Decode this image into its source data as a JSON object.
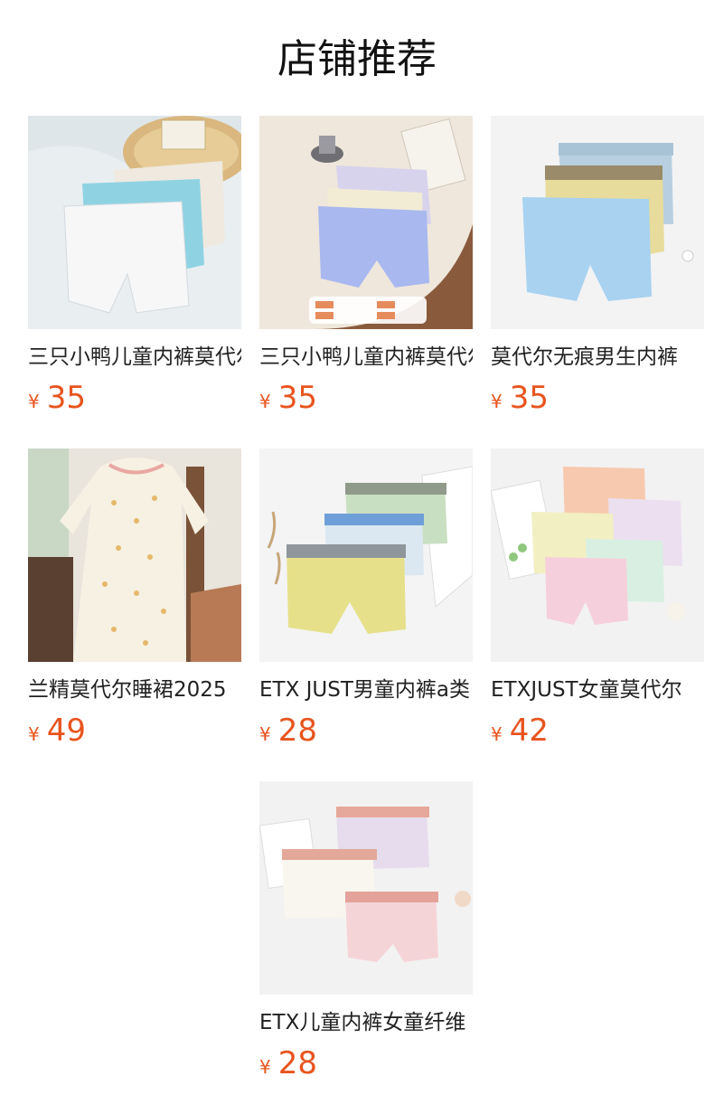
{
  "section": {
    "title": "店铺推荐"
  },
  "products": [
    {
      "name": "三只小鸭儿童内裤莫代尔",
      "currency": "¥",
      "price": "35",
      "image_icon": "kids-underwear-photo-icon"
    },
    {
      "name": "三只小鸭儿童内裤莫代尔",
      "currency": "¥",
      "price": "35",
      "image_icon": "kids-underwear-photo-icon"
    },
    {
      "name": "莫代尔无痕男生内裤",
      "currency": "¥",
      "price": "35",
      "image_icon": "boxer-briefs-photo-icon"
    },
    {
      "name": "兰精莫代尔睡裙2025",
      "currency": "¥",
      "price": "49",
      "image_icon": "nightdress-photo-icon"
    },
    {
      "name": "ETX JUST男童内裤a类",
      "currency": "¥",
      "price": "28",
      "image_icon": "boxer-briefs-photo-icon"
    },
    {
      "name": "ETXJUST女童莫代尔",
      "currency": "¥",
      "price": "42",
      "image_icon": "girls-underwear-photo-icon"
    },
    {
      "name": "ETX儿童内裤女童纤维",
      "currency": "¥",
      "price": "28",
      "image_icon": "girls-underwear-photo-icon"
    }
  ],
  "colors": {
    "price": "#e8541e",
    "title": "#111111",
    "text": "#222222"
  }
}
